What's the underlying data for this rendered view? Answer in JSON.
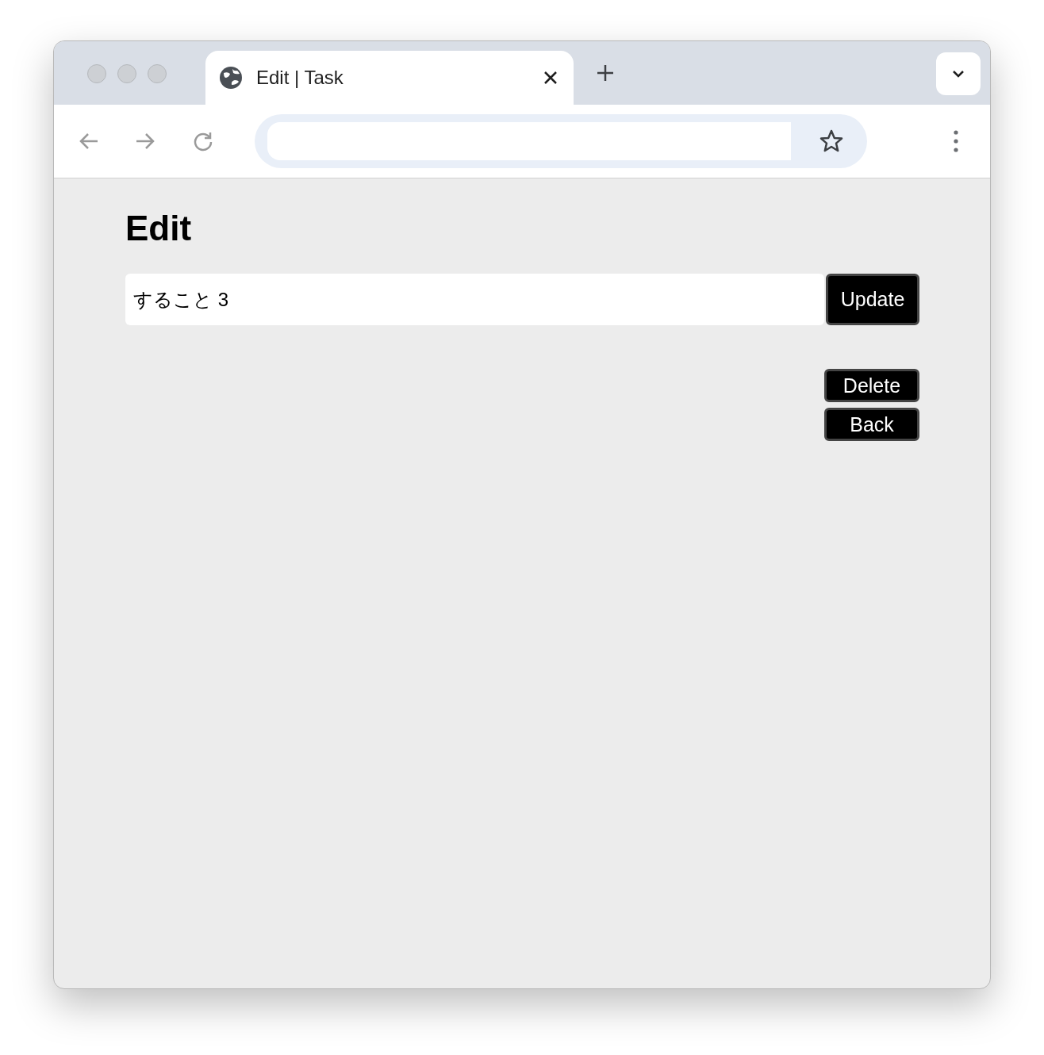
{
  "browser": {
    "tab": {
      "title": "Edit | Task"
    }
  },
  "page": {
    "heading": "Edit",
    "task_field": {
      "value": "すること 3"
    },
    "update_button": "Update",
    "actions": [
      "Delete",
      "Back"
    ]
  }
}
